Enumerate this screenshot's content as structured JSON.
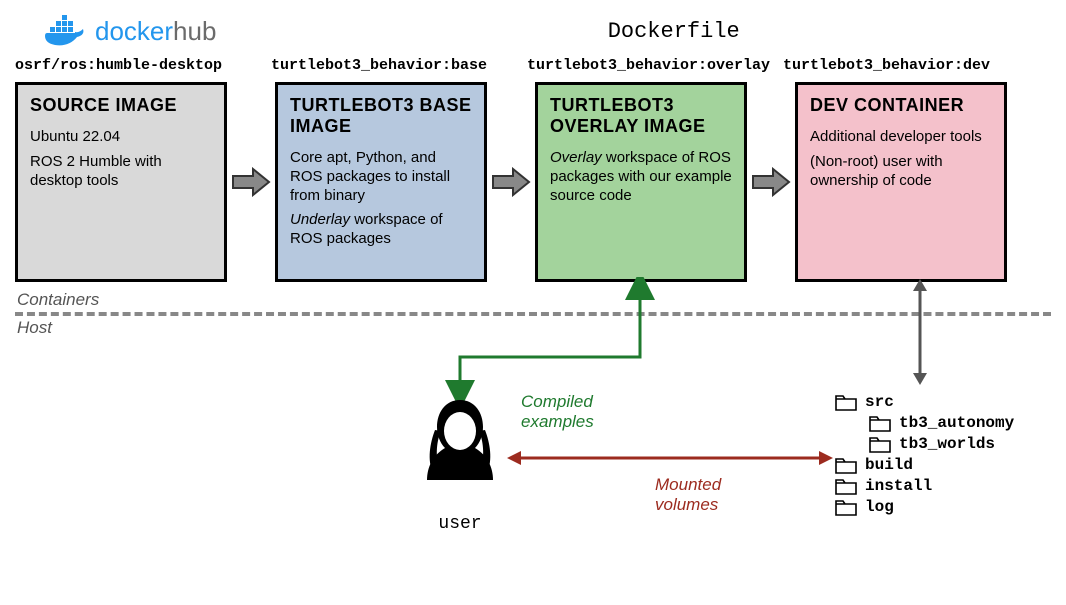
{
  "header": {
    "logo_text_a": "docker",
    "logo_text_b": "hub",
    "dockerfile_label": "Dockerfile"
  },
  "tags": {
    "source": "osrf/ros:humble-desktop",
    "base": "turtlebot3_behavior:base",
    "overlay": "turtlebot3_behavior:overlay",
    "dev": "turtlebot3_behavior:dev"
  },
  "boxes": {
    "source": {
      "title": "SOURCE IMAGE",
      "line1": "Ubuntu 22.04",
      "line2": "ROS 2 Humble with desktop tools"
    },
    "base": {
      "title": "TURTLEBOT3 BASE IMAGE",
      "line1": "Core apt, Python, and ROS packages to install from binary",
      "line2_prefix": "Underlay",
      "line2_rest": " workspace of ROS packages"
    },
    "overlay": {
      "title": "TURTLEBOT3 OVERLAY IMAGE",
      "line1_prefix": "Overlay",
      "line1_rest": " workspace of ROS packages with our example source code"
    },
    "dev": {
      "title": "DEV CONTAINER",
      "line1": "Additional developer tools",
      "line2": "(Non-root) user with ownership of code"
    }
  },
  "separator": {
    "containers": "Containers",
    "host": "Host"
  },
  "lower": {
    "user": "user",
    "compiled": "Compiled examples",
    "mounted": "Mounted volumes"
  },
  "filetree": {
    "src": "src",
    "tb3_autonomy": "tb3_autonomy",
    "tb3_worlds": "tb3_worlds",
    "build": "build",
    "install": "install",
    "log": "log"
  }
}
